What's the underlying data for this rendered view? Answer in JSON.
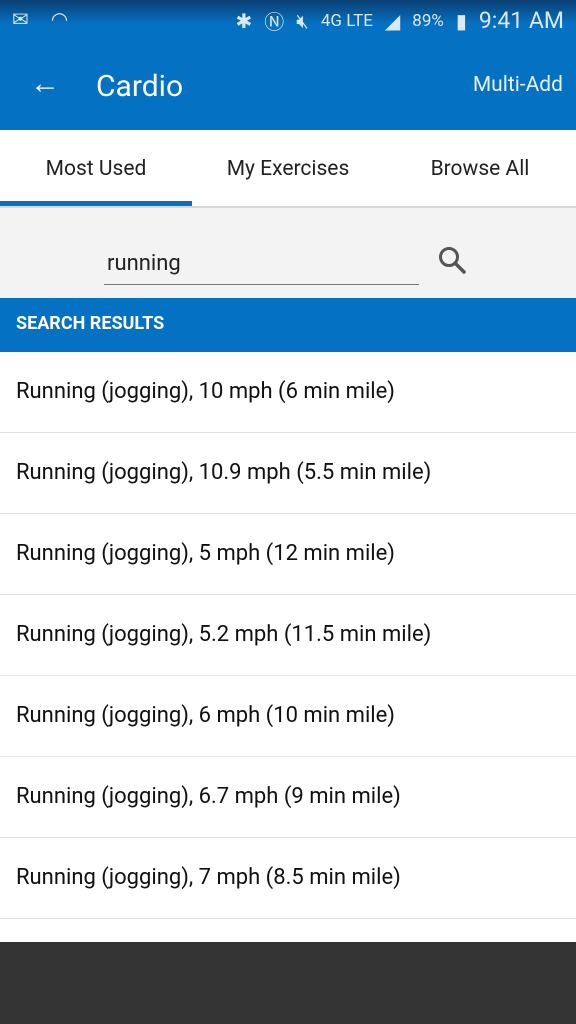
{
  "status_bar": {
    "time": "9:41 AM",
    "battery": "89%",
    "network": "4G LTE"
  },
  "app_bar": {
    "title": "Cardio",
    "action": "Multi-Add"
  },
  "tabs": [
    {
      "label": "Most Used",
      "active": true
    },
    {
      "label": "My Exercises",
      "active": false
    },
    {
      "label": "Browse All",
      "active": false
    }
  ],
  "search": {
    "value": "running"
  },
  "results_header": "SEARCH RESULTS",
  "results": [
    "Running (jogging), 10 mph (6 min mile)",
    "Running (jogging), 10.9 mph (5.5 min mile)",
    "Running (jogging), 5 mph (12 min mile)",
    "Running (jogging), 5.2 mph (11.5 min mile)",
    "Running (jogging), 6 mph (10 min mile)",
    "Running (jogging), 6.7 mph (9 min mile)",
    "Running (jogging), 7 mph (8.5 min mile)"
  ],
  "colors": {
    "primary": "#0571c3",
    "nav_bar": "#333333"
  }
}
